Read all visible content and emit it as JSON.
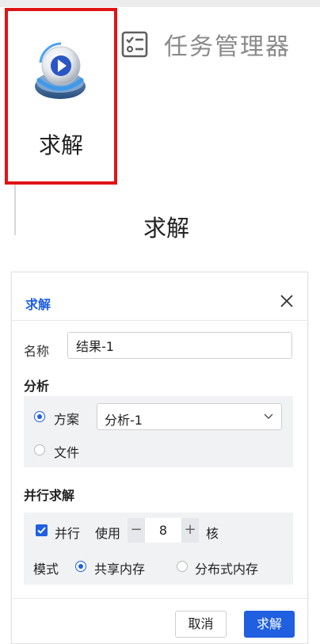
{
  "ribbon": {
    "solve_button_label": "求解",
    "task_manager_label": "任务管理器",
    "group_label": "求解"
  },
  "dialog": {
    "title": "求解",
    "name_label": "名称",
    "name_value": "结果-1",
    "analysis_section": "分析",
    "scheme_option": "方案",
    "scheme_selected": "分析-1",
    "file_option": "文件",
    "parallel_section": "并行求解",
    "parallel_checkbox_label": "并行",
    "use_label": "使用",
    "cores_value": "8",
    "cores_unit": "核",
    "mode_label": "模式",
    "shared_memory_option": "共享内存",
    "distributed_memory_option": "分布式内存",
    "cancel_label": "取消",
    "submit_label": "求解"
  },
  "colors": {
    "accent": "#1f5fe0",
    "highlight_border": "#e01414"
  },
  "icons": {
    "solve": "solve-play-disc-icon",
    "task_manager": "checklist-icon",
    "close": "close-icon",
    "dropdown": "chevron-down-icon"
  }
}
